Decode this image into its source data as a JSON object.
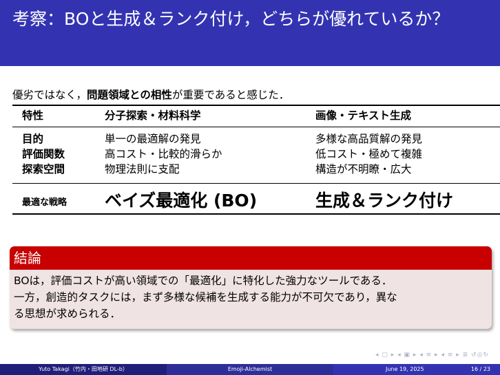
{
  "slide": {
    "title": "考察：BOと生成＆ランク付け，どちらが優れているか？"
  },
  "intro": {
    "pre": "優劣ではなく，",
    "bold": "問題領域との相性",
    "post": "が重要であると感じた．"
  },
  "table": {
    "headers": [
      "特性",
      "分子探索・材料科学",
      "画像・テキスト生成"
    ],
    "rows": [
      {
        "label": "目的",
        "bo": "単一の最適解の発見",
        "gen": "多様な高品質解の発見"
      },
      {
        "label": "評価関数",
        "bo": "高コスト・比較的滑らか",
        "gen": "低コスト・極めて複雑"
      },
      {
        "label": "探索空間",
        "bo": "物理法則に支配",
        "gen": "構造が不明瞭・広大"
      }
    ],
    "strategy": {
      "label": "最適な戦略",
      "bo": "ベイズ最適化 (BO)",
      "gen": "生成＆ランク付け"
    }
  },
  "conclusion": {
    "heading": "結論",
    "line1": "BOは，評価コストが高い領域での「最適化」に特化した強力なツールである．",
    "line2": "一方，創造的タスクには，まず多様な候補を生成する能力が不可欠であり，異な",
    "line3": "る思想が求められる．"
  },
  "footer": {
    "author": "Yuto Takagi（竹内・田地研 DL-b）",
    "short_title": "Emoji-Alchemist",
    "date": "June 19, 2025",
    "page": "16 / 23"
  },
  "icons": [
    "nav-frame-icon",
    "nav-subsection-icon",
    "nav-section-icon",
    "nav-search-icon"
  ]
}
